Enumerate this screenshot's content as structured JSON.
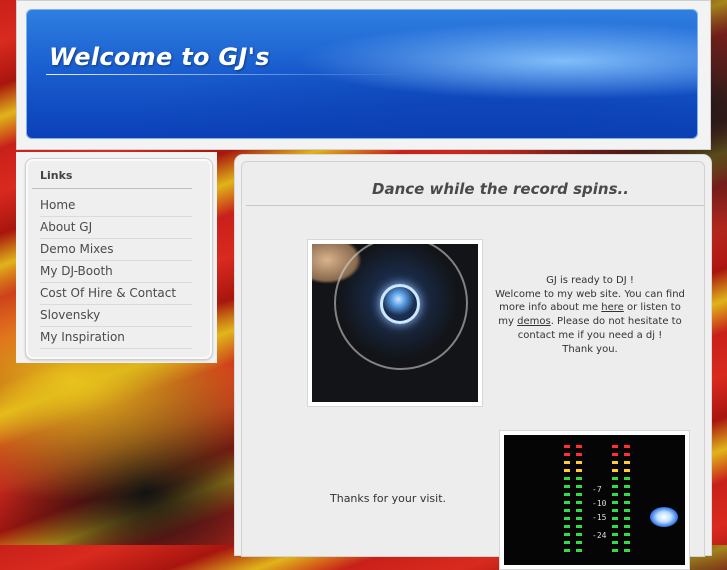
{
  "header": {
    "title": "Welcome to GJ's"
  },
  "sidebar": {
    "heading": "Links",
    "items": [
      {
        "label": "Home"
      },
      {
        "label": "About GJ"
      },
      {
        "label": "Demo Mixes"
      },
      {
        "label": "My DJ-Booth"
      },
      {
        "label": "Cost Of Hire & Contact"
      },
      {
        "label": "Slovensky"
      },
      {
        "label": "My Inspiration"
      }
    ]
  },
  "main": {
    "heading": "Dance while the record spins..",
    "welcome": {
      "line1": "GJ is ready to DJ !",
      "line2": "Welcome to my web site. You can find",
      "line3_pre": "more info about me ",
      "link_here": "here",
      "line3_post": " or listen to",
      "line4_pre": "my ",
      "link_demos": "demos",
      "line4_post": ". Please do not hesitate to",
      "line5": "contact me if you need a dj !",
      "line6": "Thank you."
    },
    "thanks": "Thanks for your visit.",
    "mixer_labels": [
      "-15",
      "-24",
      "-10",
      "-7"
    ]
  },
  "colors": {
    "banner_blue": "#1a5fd0",
    "panel_bg": "#f3f3f3",
    "nav_text": "#4a4a4a"
  }
}
